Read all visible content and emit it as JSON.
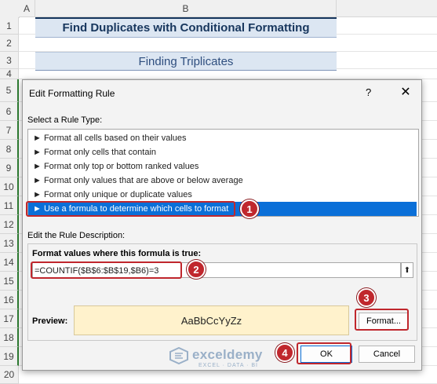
{
  "sheet": {
    "columns": [
      "A",
      "B"
    ],
    "rows": [
      "1",
      "2",
      "3",
      "4",
      "5",
      "6",
      "7",
      "8",
      "9",
      "10",
      "11",
      "12",
      "13",
      "14",
      "15",
      "16",
      "17",
      "18",
      "19",
      "20"
    ],
    "title": "Find Duplicates with Conditional Formatting",
    "subtitle": "Finding Triplicates"
  },
  "dialog": {
    "title": "Edit Formatting Rule",
    "help": "?",
    "close": "✕",
    "select_label": "Select a Rule Type:",
    "rule_types": [
      "► Format all cells based on their values",
      "► Format only cells that contain",
      "► Format only top or bottom ranked values",
      "► Format only values that are above or below average",
      "► Format only unique or duplicate values",
      "► Use a formula to determine which cells to format"
    ],
    "edit_label": "Edit the Rule Description:",
    "formula_label": "Format values where this formula is true:",
    "formula_value": "=COUNTIF($B$6:$B$19,$B6)=3",
    "collapse_icon": "⬆",
    "preview_label": "Preview:",
    "preview_text": "AaBbCcYyZz",
    "format_button": "Format...",
    "ok_button": "OK",
    "cancel_button": "Cancel"
  },
  "callouts": [
    "1",
    "2",
    "3",
    "4"
  ],
  "watermark": {
    "name": "exceldemy",
    "tagline": "EXCEL · DATA · BI"
  },
  "colors": {
    "accent": "#0a6fd8",
    "callout": "#c0272d",
    "title_band": "#dce6f2",
    "preview_bg": "#fff2cc"
  }
}
